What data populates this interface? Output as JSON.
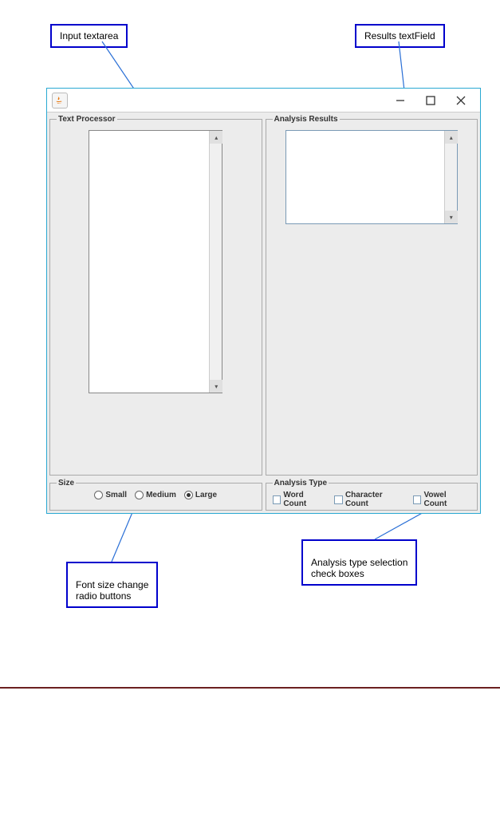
{
  "callouts": {
    "input_textarea": "Input textarea",
    "results_textfield": "Results textField",
    "font_size_radios": "Font size change\nradio buttons",
    "analysis_checkboxes": "Analysis type selection\ncheck boxes"
  },
  "panels": {
    "text_processor_title": "Text Processor",
    "analysis_results_title": "Analysis Results",
    "size_title": "Size",
    "analysis_type_title": "Analysis Type"
  },
  "size_options": {
    "small": "Small",
    "medium": "Medium",
    "large": "Large",
    "selected": "large"
  },
  "analysis_options": {
    "word_count": "Word Count",
    "character_count": "Character Count",
    "vowel_count": "Vowel Count"
  },
  "textarea_value": "",
  "results_value": ""
}
